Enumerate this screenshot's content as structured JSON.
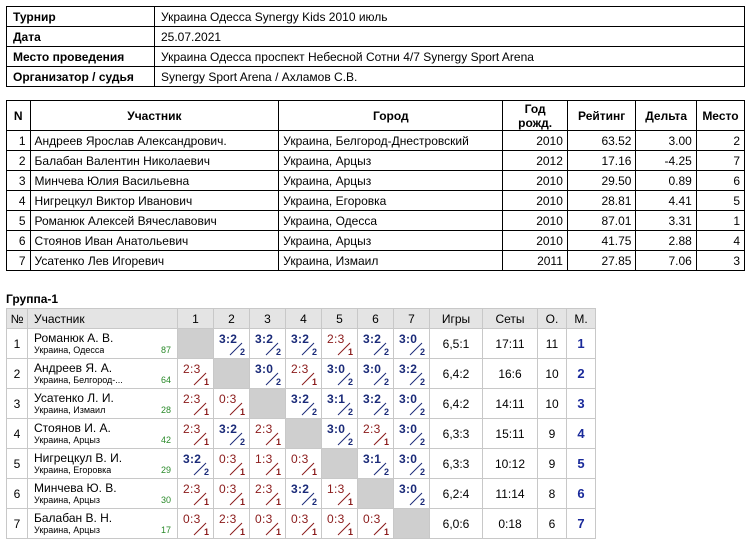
{
  "info": [
    {
      "label": "Турнир",
      "value": "Украина Одесса Synergy Kids 2010 июль"
    },
    {
      "label": "Дата",
      "value": "25.07.2021"
    },
    {
      "label": "Место проведения",
      "value": "Украина Одесса проспект Небесной Сотни 4/7 Synergy Sport Arena"
    },
    {
      "label": "Организатор / судья",
      "value": "Synergy Sport Arena / Ахламов С.В."
    }
  ],
  "participants": {
    "headers": [
      "N",
      "Участник",
      "Город",
      "Год рожд.",
      "Рейтинг",
      "Дельта",
      "Место"
    ],
    "rows": [
      {
        "n": "1",
        "name": "Андреев Ярослав Александрович.",
        "city": "Украина, Белгород-Днестровский",
        "year": "2010",
        "rating": "63.52",
        "delta": "3.00",
        "place": "2"
      },
      {
        "n": "2",
        "name": "Балабан Валентин Николаевич",
        "city": "Украина, Арцыз",
        "year": "2012",
        "rating": "17.16",
        "delta": "-4.25",
        "place": "7"
      },
      {
        "n": "3",
        "name": "Минчева Юлия Васильевна",
        "city": "Украина, Арцыз",
        "year": "2010",
        "rating": "29.50",
        "delta": "0.89",
        "place": "6"
      },
      {
        "n": "4",
        "name": "Нигрецкул Виктор Иванович",
        "city": "Украина, Егоровка",
        "year": "2010",
        "rating": "28.81",
        "delta": "4.41",
        "place": "5"
      },
      {
        "n": "5",
        "name": "Романюк Алексей Вячеславович",
        "city": "Украина, Одесса",
        "year": "2010",
        "rating": "87.01",
        "delta": "3.31",
        "place": "1"
      },
      {
        "n": "6",
        "name": "Стоянов Иван Анатольевич",
        "city": "Украина, Арцыз",
        "year": "2010",
        "rating": "41.75",
        "delta": "2.88",
        "place": "4"
      },
      {
        "n": "7",
        "name": "Усатенко Лев Игоревич",
        "city": "Украина, Измаил",
        "year": "2011",
        "rating": "27.85",
        "delta": "7.06",
        "place": "3"
      }
    ]
  },
  "group": {
    "title": "Группа-1",
    "headers": [
      "№",
      "Участник",
      "1",
      "2",
      "3",
      "4",
      "5",
      "6",
      "7",
      "Игры",
      "Сеты",
      "О.",
      "М."
    ],
    "rows": [
      {
        "n": "1",
        "name": "Романюк А. В.",
        "city": "Украина, Одесса",
        "rating": "87",
        "cells": [
          null,
          {
            "s": "3:2",
            "r": "2",
            "w": true
          },
          {
            "s": "3:2",
            "r": "2",
            "w": true
          },
          {
            "s": "3:2",
            "r": "2",
            "w": true
          },
          {
            "s": "2:3",
            "r": "1",
            "w": false
          },
          {
            "s": "3:2",
            "r": "2",
            "w": true
          },
          {
            "s": "3:0",
            "r": "2",
            "w": true
          }
        ],
        "games": "6,5:1",
        "sets": "17:11",
        "points": "11",
        "place": "1"
      },
      {
        "n": "2",
        "name": "Андреев Я. А.",
        "city": "Украина, Белгород-...",
        "rating": "64",
        "cells": [
          {
            "s": "2:3",
            "r": "1",
            "w": false
          },
          null,
          {
            "s": "3:0",
            "r": "2",
            "w": true
          },
          {
            "s": "2:3",
            "r": "1",
            "w": false
          },
          {
            "s": "3:0",
            "r": "2",
            "w": true
          },
          {
            "s": "3:0",
            "r": "2",
            "w": true
          },
          {
            "s": "3:2",
            "r": "2",
            "w": true
          }
        ],
        "games": "6,4:2",
        "sets": "16:6",
        "points": "10",
        "place": "2"
      },
      {
        "n": "3",
        "name": "Усатенко Л. И.",
        "city": "Украина, Измаил",
        "rating": "28",
        "cells": [
          {
            "s": "2:3",
            "r": "1",
            "w": false
          },
          {
            "s": "0:3",
            "r": "1",
            "w": false
          },
          null,
          {
            "s": "3:2",
            "r": "2",
            "w": true
          },
          {
            "s": "3:1",
            "r": "2",
            "w": true
          },
          {
            "s": "3:2",
            "r": "2",
            "w": true
          },
          {
            "s": "3:0",
            "r": "2",
            "w": true
          }
        ],
        "games": "6,4:2",
        "sets": "14:11",
        "points": "10",
        "place": "3"
      },
      {
        "n": "4",
        "name": "Стоянов И. А.",
        "city": "Украина, Арцыз",
        "rating": "42",
        "cells": [
          {
            "s": "2:3",
            "r": "1",
            "w": false
          },
          {
            "s": "3:2",
            "r": "2",
            "w": true
          },
          {
            "s": "2:3",
            "r": "1",
            "w": false
          },
          null,
          {
            "s": "3:0",
            "r": "2",
            "w": true
          },
          {
            "s": "2:3",
            "r": "1",
            "w": false
          },
          {
            "s": "3:0",
            "r": "2",
            "w": true
          }
        ],
        "games": "6,3:3",
        "sets": "15:11",
        "points": "9",
        "place": "4"
      },
      {
        "n": "5",
        "name": "Нигрецкул В. И.",
        "city": "Украина, Егоровка",
        "rating": "29",
        "cells": [
          {
            "s": "3:2",
            "r": "2",
            "w": true
          },
          {
            "s": "0:3",
            "r": "1",
            "w": false
          },
          {
            "s": "1:3",
            "r": "1",
            "w": false
          },
          {
            "s": "0:3",
            "r": "1",
            "w": false
          },
          null,
          {
            "s": "3:1",
            "r": "2",
            "w": true
          },
          {
            "s": "3:0",
            "r": "2",
            "w": true
          }
        ],
        "games": "6,3:3",
        "sets": "10:12",
        "points": "9",
        "place": "5"
      },
      {
        "n": "6",
        "name": "Минчева Ю. В.",
        "city": "Украина, Арцыз",
        "rating": "30",
        "cells": [
          {
            "s": "2:3",
            "r": "1",
            "w": false
          },
          {
            "s": "0:3",
            "r": "1",
            "w": false
          },
          {
            "s": "2:3",
            "r": "1",
            "w": false
          },
          {
            "s": "3:2",
            "r": "2",
            "w": true
          },
          {
            "s": "1:3",
            "r": "1",
            "w": false
          },
          null,
          {
            "s": "3:0",
            "r": "2",
            "w": true
          }
        ],
        "games": "6,2:4",
        "sets": "11:14",
        "points": "8",
        "place": "6"
      },
      {
        "n": "7",
        "name": "Балабан В. Н.",
        "city": "Украина, Арцыз",
        "rating": "17",
        "cells": [
          {
            "s": "0:3",
            "r": "1",
            "w": false
          },
          {
            "s": "2:3",
            "r": "1",
            "w": false
          },
          {
            "s": "0:3",
            "r": "1",
            "w": false
          },
          {
            "s": "0:3",
            "r": "1",
            "w": false
          },
          {
            "s": "0:3",
            "r": "1",
            "w": false
          },
          {
            "s": "0:3",
            "r": "1",
            "w": false
          },
          null
        ],
        "games": "6,0:6",
        "sets": "0:18",
        "points": "6",
        "place": "7"
      }
    ]
  }
}
